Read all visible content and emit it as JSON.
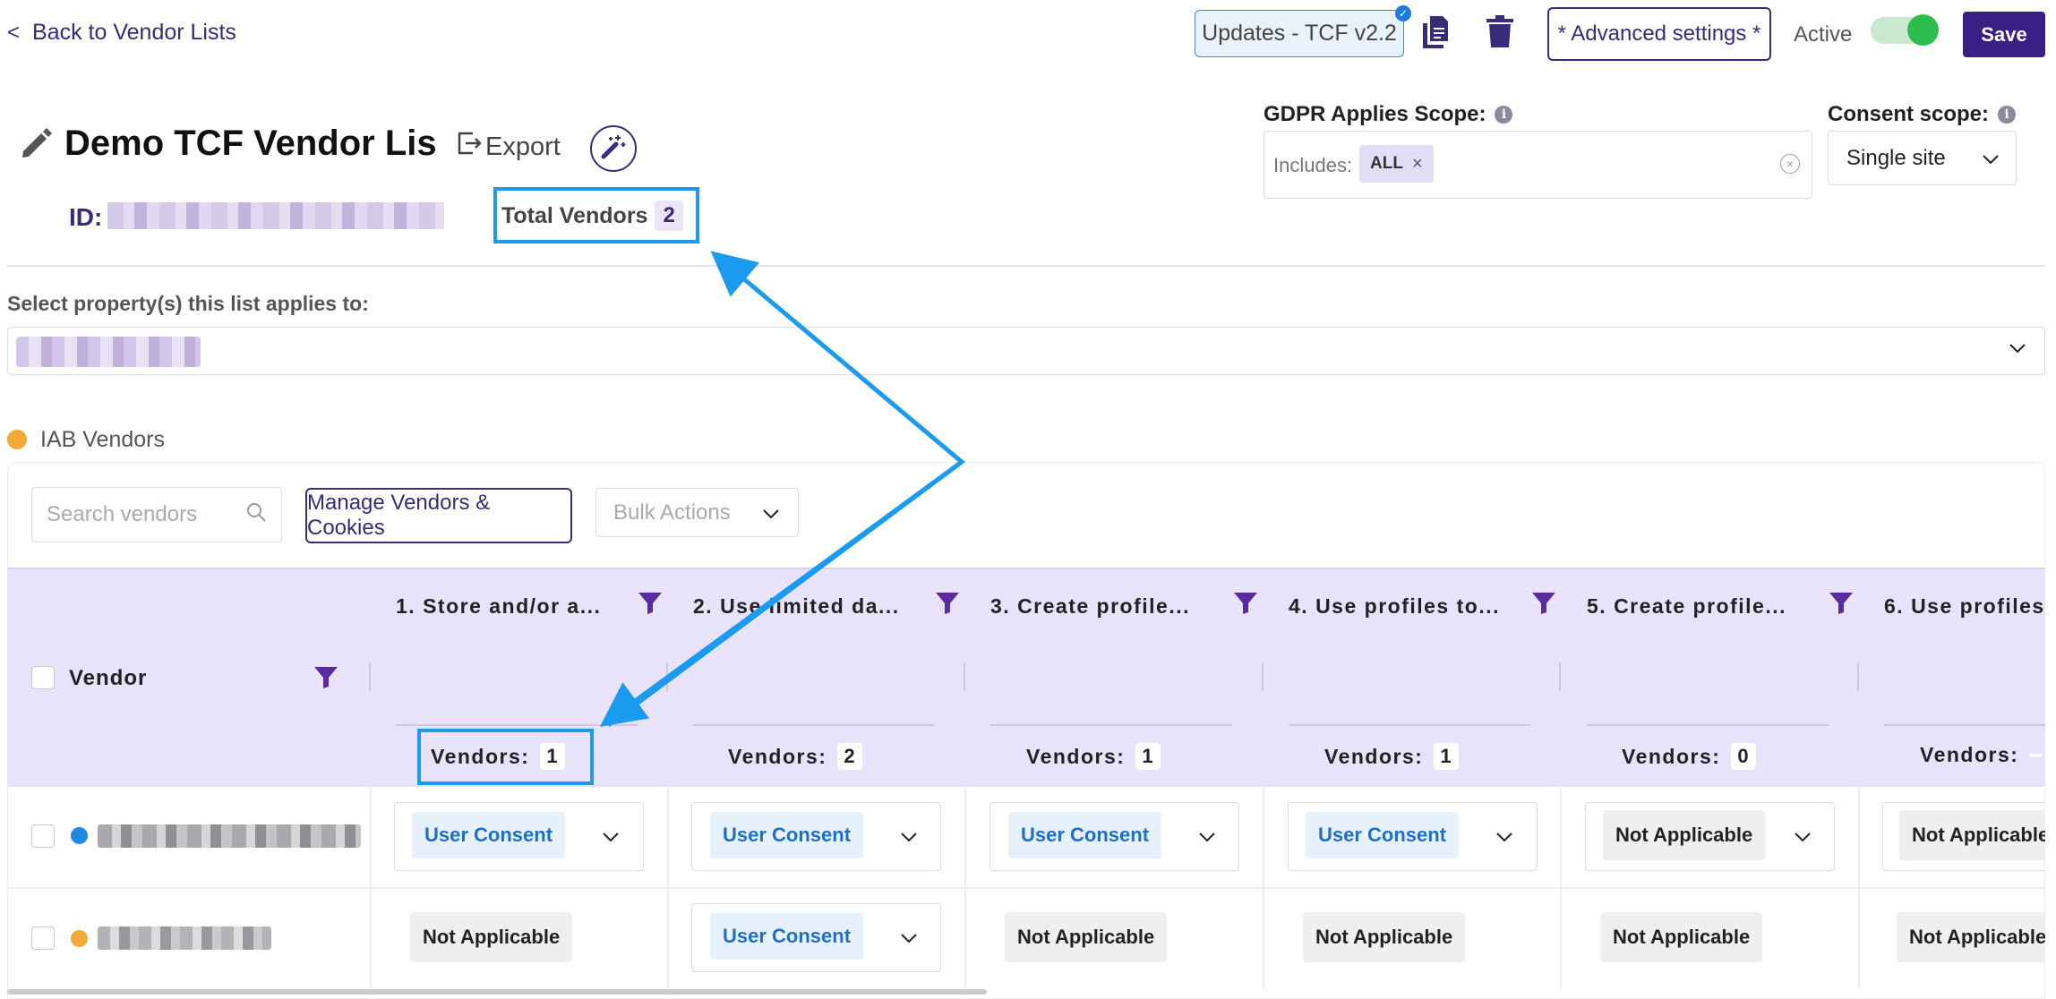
{
  "header": {
    "back_label": "Back to Vendor Lists",
    "updates_label": "Updates - TCF v2.2",
    "advanced_label": "* Advanced settings *",
    "active_label": "Active",
    "save_label": "Save"
  },
  "list": {
    "title": "Demo TCF Vendor List",
    "export_label": "Export",
    "id_label": "ID:",
    "total_vendors_label": "Total Vendors",
    "total_vendors_count": "2"
  },
  "scope": {
    "gdpr_label": "GDPR Applies Scope:",
    "includes_label": "Includes:",
    "includes_chip": "ALL",
    "consent_label": "Consent scope:",
    "consent_value": "Single site"
  },
  "property": {
    "label": "Select property(s) this list applies to:"
  },
  "iab": {
    "label": "IAB Vendors",
    "search_placeholder": "Search vendors",
    "manage_label": "Manage Vendors & Cookies",
    "bulk_label": "Bulk Actions"
  },
  "table": {
    "vendor_header": "Vendor",
    "vendors_label": "Vendors:",
    "columns": [
      {
        "title": "1. Store and/or a...",
        "count": "1"
      },
      {
        "title": "2. Use limited da...",
        "count": "2"
      },
      {
        "title": "3. Create profile...",
        "count": "1"
      },
      {
        "title": "4. Use profiles to...",
        "count": "1"
      },
      {
        "title": "5. Create profile...",
        "count": "0"
      },
      {
        "title": "6. Use profiles",
        "count": ""
      }
    ],
    "rows": [
      {
        "dot_color": "#1e8ae6",
        "cells": [
          "User Consent",
          "User Consent",
          "User Consent",
          "User Consent",
          "Not Applicable",
          "Not Applicable"
        ]
      },
      {
        "dot_color": "#f3a935",
        "cells": [
          "Not Applicable",
          "User Consent",
          "Not Applicable",
          "Not Applicable",
          "Not Applicable",
          "Not Applicable"
        ]
      }
    ]
  },
  "colors": {
    "brand": "#3b1e84",
    "header_bg": "#e8e2fb",
    "annotation": "#1b9bf0",
    "active_toggle": "#2dbe4e"
  },
  "icons": [
    "chevron-left-icon",
    "document-icon",
    "trash-icon",
    "pencil-icon",
    "export-icon",
    "magic-wand-icon",
    "info-icon",
    "close-icon",
    "clear-circle-icon",
    "chevron-down-icon",
    "search-icon",
    "filter-icon"
  ]
}
